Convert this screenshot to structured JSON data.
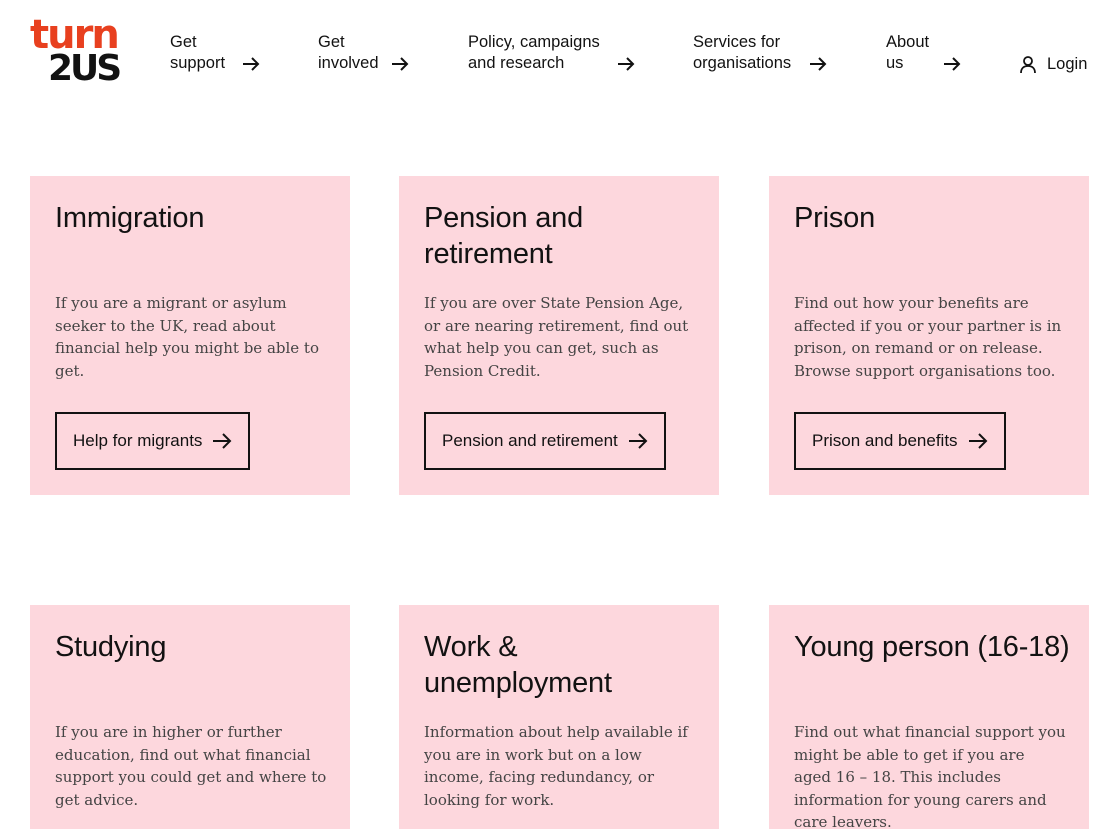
{
  "brand": {
    "logo_top": "turn",
    "logo_bottom": "2US",
    "accent_color": "#e8401f",
    "card_color": "#fdd7dd"
  },
  "nav": {
    "items": [
      {
        "label": "Get\nsupport",
        "icon": "arrow-right-icon"
      },
      {
        "label": "Get\ninvolved",
        "icon": "arrow-right-icon"
      },
      {
        "label": "Policy, campaigns\nand research",
        "icon": "arrow-right-icon"
      },
      {
        "label": "Services for\norganisations",
        "icon": "arrow-right-icon"
      },
      {
        "label": "About\nus",
        "icon": "arrow-right-icon"
      }
    ],
    "login_label": "Login",
    "login_icon": "user-icon"
  },
  "cards": [
    {
      "title": "Immigration",
      "description": "If you are a migrant or asylum seeker to the UK, read about financial help you might be able to get.",
      "button": "Help for migrants"
    },
    {
      "title": "Pension and retirement",
      "description": "If you are over State Pension Age, or are nearing retirement, find out what help you can get, such as Pension Credit.",
      "button": "Pension and retirement"
    },
    {
      "title": "Prison",
      "description": "Find out how your benefits are affected if you or your partner is in prison, on remand or on release. Browse support organisations too.",
      "button": "Prison and benefits"
    },
    {
      "title": "Studying",
      "description": "If you are in higher or further education, find out what financial support you could get and where to get advice."
    },
    {
      "title": "Work & unemployment",
      "description": "Information about help available if you are in work but on a low income, facing redundancy, or looking for work."
    },
    {
      "title": "Young person (16-18)",
      "description": "Find out what financial support you might be able to get if you are aged 16 – 18. This includes information for young carers and care leavers."
    }
  ]
}
